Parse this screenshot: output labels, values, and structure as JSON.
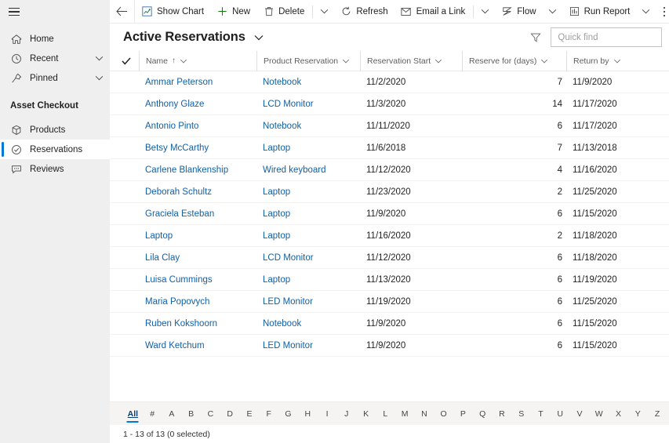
{
  "sidebar": {
    "hamburger_name": "site-map-toggle",
    "top_items": [
      {
        "label": "Home",
        "icon": "home-icon",
        "chevron": false
      },
      {
        "label": "Recent",
        "icon": "clock-icon",
        "chevron": true
      },
      {
        "label": "Pinned",
        "icon": "pin-icon",
        "chevron": true
      }
    ],
    "section_title": "Asset Checkout",
    "group_items": [
      {
        "label": "Products",
        "icon": "box-icon",
        "selected": false
      },
      {
        "label": "Reservations",
        "icon": "check-circle-icon",
        "selected": true
      },
      {
        "label": "Reviews",
        "icon": "comment-icon",
        "selected": false
      }
    ]
  },
  "commandbar": {
    "back_icon": "back-arrow-icon",
    "buttons": [
      {
        "label": "Show Chart",
        "icon": "chart-icon"
      },
      {
        "label": "New",
        "icon": "plus-icon"
      },
      {
        "label": "Delete",
        "icon": "trash-icon"
      },
      {
        "label": "Refresh",
        "icon": "refresh-icon"
      },
      {
        "label": "Email a Link",
        "icon": "email-link-icon"
      },
      {
        "label": "Flow",
        "icon": "flow-icon"
      },
      {
        "label": "Run Report",
        "icon": "report-icon"
      }
    ],
    "overflow_label": "More commands"
  },
  "view": {
    "title": "Active Reservations",
    "title_chevron": "chevron-down-icon",
    "filter_icon": "filter-icon",
    "search": {
      "placeholder": "Quick find",
      "value": "",
      "icon": "search-icon"
    }
  },
  "grid": {
    "select_all_icon": "checkmark-icon",
    "columns": [
      {
        "key": "name",
        "label": "Name",
        "sorted": true,
        "sort_dir": "asc",
        "align": "left"
      },
      {
        "key": "prod",
        "label": "Product Reservation",
        "sorted": false,
        "align": "left"
      },
      {
        "key": "start",
        "label": "Reservation Start",
        "sorted": false,
        "align": "left"
      },
      {
        "key": "days",
        "label": "Reserve for (days)",
        "sorted": false,
        "align": "right"
      },
      {
        "key": "ret",
        "label": "Return by",
        "sorted": false,
        "align": "left"
      }
    ],
    "sort_asc_glyph": "↑",
    "rows": [
      {
        "name": "Ammar Peterson",
        "prod": "Notebook",
        "start": "11/2/2020",
        "days": "7",
        "ret": "11/9/2020"
      },
      {
        "name": "Anthony Glaze",
        "prod": "LCD Monitor",
        "start": "11/3/2020",
        "days": "14",
        "ret": "11/17/2020"
      },
      {
        "name": "Antonio Pinto",
        "prod": "Notebook",
        "start": "11/11/2020",
        "days": "6",
        "ret": "11/17/2020"
      },
      {
        "name": "Betsy McCarthy",
        "prod": "Laptop",
        "start": "11/6/2018",
        "days": "7",
        "ret": "11/13/2018"
      },
      {
        "name": "Carlene Blankenship",
        "prod": "Wired keyboard",
        "start": "11/12/2020",
        "days": "4",
        "ret": "11/16/2020"
      },
      {
        "name": "Deborah Schultz",
        "prod": "Laptop",
        "start": "11/23/2020",
        "days": "2",
        "ret": "11/25/2020"
      },
      {
        "name": "Graciela Esteban",
        "prod": "Laptop",
        "start": "11/9/2020",
        "days": "6",
        "ret": "11/15/2020"
      },
      {
        "name": "Laptop",
        "prod": "Laptop",
        "start": "11/16/2020",
        "days": "2",
        "ret": "11/18/2020"
      },
      {
        "name": "Lila Clay",
        "prod": "LCD Monitor",
        "start": "11/12/2020",
        "days": "6",
        "ret": "11/18/2020"
      },
      {
        "name": "Luisa Cummings",
        "prod": "Laptop",
        "start": "11/13/2020",
        "days": "6",
        "ret": "11/19/2020"
      },
      {
        "name": "Maria Popovych",
        "prod": "LED Monitor",
        "start": "11/19/2020",
        "days": "6",
        "ret": "11/25/2020"
      },
      {
        "name": "Ruben Kokshoorn",
        "prod": "Notebook",
        "start": "11/9/2020",
        "days": "6",
        "ret": "11/15/2020"
      },
      {
        "name": "Ward Ketchum",
        "prod": "LED Monitor",
        "start": "11/9/2020",
        "days": "6",
        "ret": "11/15/2020"
      }
    ]
  },
  "alphabar": {
    "active": "All",
    "items": [
      "All",
      "#",
      "A",
      "B",
      "C",
      "D",
      "E",
      "F",
      "G",
      "H",
      "I",
      "J",
      "K",
      "L",
      "M",
      "N",
      "O",
      "P",
      "Q",
      "R",
      "S",
      "T",
      "U",
      "V",
      "W",
      "X",
      "Y",
      "Z"
    ]
  },
  "footer": {
    "status": "1 - 13 of 13 (0 selected)"
  },
  "colors": {
    "accent": "#0078d4",
    "link": "#1160a6",
    "new_green": "#107c10",
    "sidebar_bg": "#f0eff0",
    "alphabar_bg": "#f5f4f3",
    "text": "#201f1e",
    "muted": "#605e5c"
  }
}
